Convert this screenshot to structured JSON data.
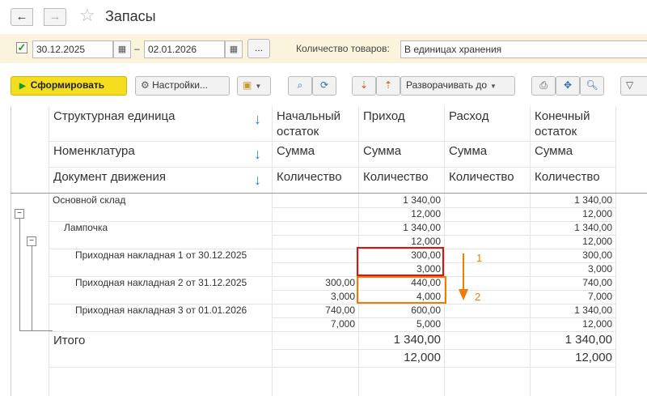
{
  "window": {
    "title": "Запасы"
  },
  "filter": {
    "date_from": "30.12.2025",
    "date_to": "02.01.2026",
    "dash": "–",
    "dots_label": "...",
    "qty_label": "Количество товаров:",
    "qty_value": "В единицах хранения"
  },
  "toolbar": {
    "run_label": "Сформировать",
    "settings_label": "Настройки...",
    "expand_label": "Разворачивать до"
  },
  "report": {
    "header": {
      "rows": [
        "Структурная единица",
        "Номенклатура",
        "Документ движения"
      ],
      "columns": [
        {
          "title": "Начальный остаток",
          "sub1": "Сумма",
          "sub2": "Количество"
        },
        {
          "title": "Приход",
          "sub1": "Сумма",
          "sub2": "Количество"
        },
        {
          "title": "Расход",
          "sub1": "Сумма",
          "sub2": "Количество"
        },
        {
          "title": "Конечный остаток",
          "sub1": "Сумма",
          "sub2": "Количество"
        }
      ]
    },
    "rows": [
      {
        "name": "Основной склад",
        "start": [
          "",
          ""
        ],
        "income": [
          "1 340,00",
          "12,000"
        ],
        "expense": [
          "",
          ""
        ],
        "end": [
          "1 340,00",
          "12,000"
        ]
      },
      {
        "name": "Лампочка",
        "start": [
          "",
          ""
        ],
        "income": [
          "1 340,00",
          "12,000"
        ],
        "expense": [
          "",
          ""
        ],
        "end": [
          "1 340,00",
          "12,000"
        ]
      },
      {
        "name": "Приходная накладная 1 от 30.12.2025",
        "start": [
          "",
          ""
        ],
        "income": [
          "300,00",
          "3,000"
        ],
        "expense": [
          "",
          ""
        ],
        "end": [
          "300,00",
          "3,000"
        ]
      },
      {
        "name": "Приходная накладная 2 от 31.12.2025",
        "start": [
          "300,00",
          "3,000"
        ],
        "income": [
          "440,00",
          "4,000"
        ],
        "expense": [
          "",
          ""
        ],
        "end": [
          "740,00",
          "7,000"
        ]
      },
      {
        "name": "Приходная накладная 3 от 01.01.2026",
        "start": [
          "740,00",
          "7,000"
        ],
        "income": [
          "600,00",
          "5,000"
        ],
        "expense": [
          "",
          ""
        ],
        "end": [
          "1 340,00",
          "12,000"
        ]
      }
    ],
    "total": {
      "label": "Итого",
      "income": [
        "1 340,00",
        "12,000"
      ],
      "end": [
        "1 340,00",
        "12,000"
      ]
    }
  },
  "annotations": {
    "label1": "1",
    "label2": "2",
    "red": "#e01010",
    "orange": "#f07c00"
  }
}
